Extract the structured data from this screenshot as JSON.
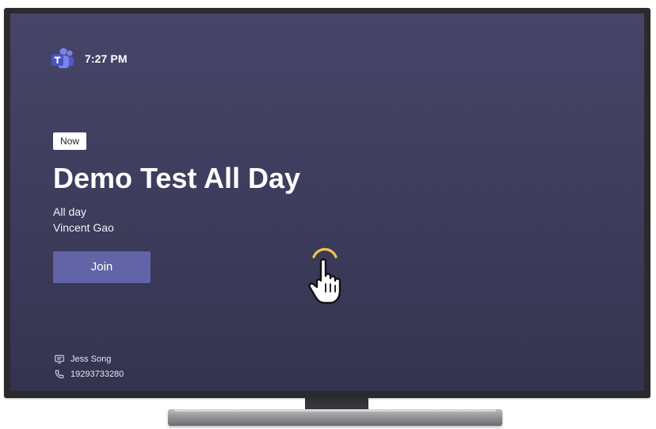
{
  "header": {
    "app_icon": "microsoft-teams-icon",
    "time": "7:27 PM"
  },
  "meeting": {
    "status": "Now",
    "title": "Demo Test All Day",
    "time_text": "All day",
    "organizer": "Vincent Gao",
    "join_label": "Join"
  },
  "room": {
    "name_icon": "room-display-icon",
    "name": "Jess Song",
    "phone_icon": "phone-icon",
    "phone": "19293733280"
  },
  "cursor": {
    "icon": "hand-pointer-icon"
  },
  "colors": {
    "screen_background": "#403f62",
    "join_button": "#6264a7",
    "status_badge": "#ffffff",
    "cursor_highlight": "#f6c343"
  }
}
